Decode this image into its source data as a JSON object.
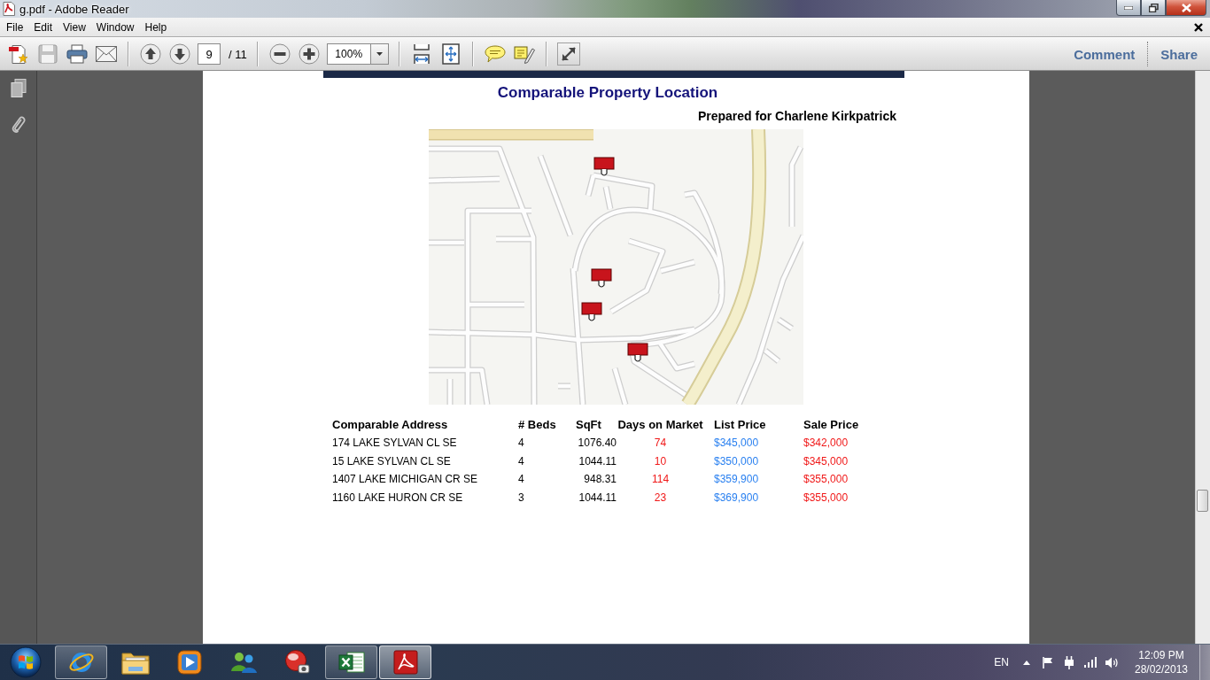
{
  "window": {
    "title": "g.pdf - Adobe Reader"
  },
  "menu_bar": {
    "items": [
      "File",
      "Edit",
      "View",
      "Window",
      "Help"
    ]
  },
  "toolbar": {
    "save": {
      "disabled": true
    },
    "page_number": "9",
    "page_total": "/ 11",
    "zoom": "100%",
    "links": [
      "Comment",
      "Share"
    ]
  },
  "document": {
    "title": "Comparable Property Location",
    "subtitle": "Prepared for Charlene Kirkpatrick",
    "table": {
      "columns": [
        "Comparable Address",
        "# Beds",
        "SqFt",
        "Days on Market",
        "List Price",
        "Sale Price"
      ],
      "rows": [
        [
          "174 LAKE SYLVAN CL SE",
          "4",
          "1076.40",
          "74",
          "$345,000",
          "$342,000"
        ],
        [
          "15 LAKE SYLVAN CL SE",
          "4",
          "1044.11",
          "10",
          "$350,000",
          "$345,000"
        ],
        [
          "1407 LAKE MICHIGAN CR SE",
          "4",
          "948.31",
          "114",
          "$359,900",
          "$355,000"
        ],
        [
          "1160 LAKE HURON CR SE",
          "3",
          "1044.11",
          "23",
          "$369,900",
          "$355,000"
        ]
      ]
    }
  },
  "taskbar": {
    "apps": [
      {
        "kind": "browser",
        "running": true,
        "selected": false
      },
      {
        "kind": "folder",
        "running": false,
        "selected": false
      },
      {
        "kind": "media",
        "running": false,
        "selected": false
      },
      {
        "kind": "people",
        "running": false,
        "selected": false
      },
      {
        "kind": "paint",
        "running": false,
        "selected": false
      },
      {
        "kind": "spreadsheet",
        "running": true,
        "selected": false
      },
      {
        "kind": "pdf",
        "running": true,
        "selected": true
      }
    ],
    "tray": {
      "language": "EN",
      "time": "12:09 PM",
      "date": "28/02/2013"
    }
  }
}
